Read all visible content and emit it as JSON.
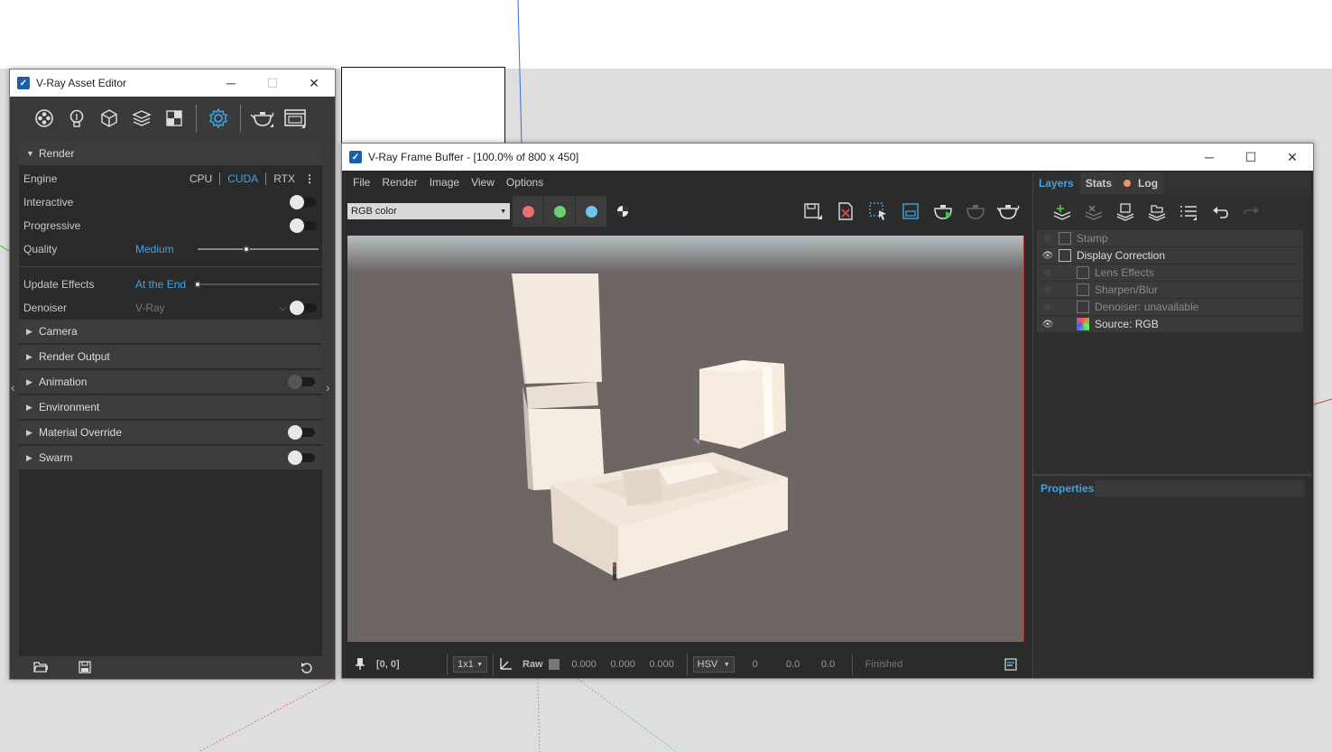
{
  "asset_editor": {
    "title": "V-Ray Asset Editor",
    "toolbar_icons": [
      "materials-icon",
      "lights-icon",
      "geometry-icon",
      "layers-icon",
      "textures-icon",
      "render-settings-icon",
      "render-icon",
      "frame-buffer-icon"
    ],
    "sections": {
      "render": "Render",
      "camera": "Camera",
      "render_output": "Render Output",
      "animation": "Animation",
      "environment": "Environment",
      "material_override": "Material Override",
      "swarm": "Swarm"
    },
    "engine": {
      "label": "Engine",
      "options": [
        "CPU",
        "CUDA",
        "RTX"
      ],
      "selected": "CUDA"
    },
    "interactive": {
      "label": "Interactive",
      "on": false
    },
    "progressive": {
      "label": "Progressive",
      "on": false
    },
    "quality": {
      "label": "Quality",
      "value": "Medium",
      "level": 0.4
    },
    "update_effects": {
      "label": "Update Effects",
      "value": "At the End",
      "level": 0.0
    },
    "denoiser": {
      "label": "Denoiser",
      "value": "V-Ray",
      "on": false
    }
  },
  "frame_buffer": {
    "title": "V-Ray Frame Buffer - [100.0% of 800 x 450]",
    "menu": [
      "File",
      "Render",
      "Image",
      "View",
      "Options"
    ],
    "channel": "RGB color",
    "channel_colors": [
      "#f07070",
      "#6cd06c",
      "#6cc4f0"
    ],
    "status": {
      "coords": "[0, 0]",
      "zoom": "1x1",
      "raw": "Raw",
      "rgb": [
        "0.000",
        "0.000",
        "0.000"
      ],
      "color_mode": "HSV",
      "hsv": [
        "0",
        "0.0",
        "0.0"
      ],
      "state": "Finished"
    },
    "tabs": [
      "Layers",
      "Stats",
      "Log"
    ],
    "active_tab": "Layers",
    "layers": [
      {
        "name": "Stamp",
        "visible": false,
        "indent": 0
      },
      {
        "name": "Display Correction",
        "visible": true,
        "indent": 0
      },
      {
        "name": "Lens Effects",
        "visible": false,
        "indent": 1
      },
      {
        "name": "Sharpen/Blur",
        "visible": false,
        "indent": 1
      },
      {
        "name": "Denoiser: unavailable",
        "visible": false,
        "indent": 1
      },
      {
        "name": "Source: RGB",
        "visible": true,
        "indent": 1
      }
    ],
    "properties_label": "Properties"
  }
}
